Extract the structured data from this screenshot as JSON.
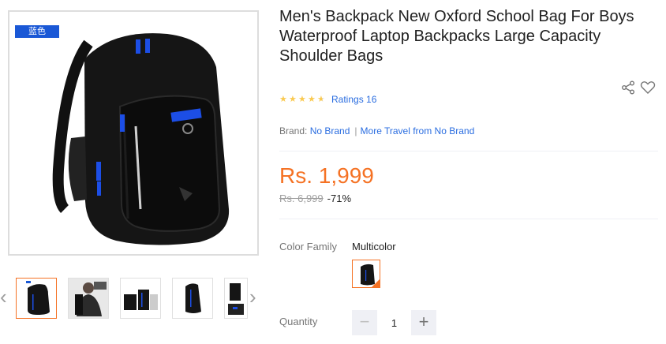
{
  "gallery": {
    "color_tag": "蓝色",
    "thumbnails": [
      {
        "name": "thumb-1",
        "active": true
      },
      {
        "name": "thumb-2",
        "active": false
      },
      {
        "name": "thumb-3",
        "active": false
      },
      {
        "name": "thumb-4",
        "active": false
      },
      {
        "name": "thumb-5",
        "active": false
      }
    ],
    "prev_icon": "chevron-left-icon",
    "next_icon": "chevron-right-icon"
  },
  "product": {
    "title": "Men's Backpack New Oxford School Bag For Boys Waterproof Laptop Backpacks Large Capacity Shoulder Bags",
    "rating": {
      "stars": 4.5,
      "label": "Ratings 16"
    },
    "brand": {
      "label": "Brand:",
      "value": "No Brand",
      "more": "More Travel from No Brand"
    },
    "price": "Rs. 1,999",
    "original_price": "Rs. 6,999",
    "discount": "-71%",
    "color_family": {
      "label": "Color Family",
      "value": "Multicolor"
    },
    "quantity": {
      "label": "Quantity",
      "value": "1",
      "minus": "−",
      "plus": "+"
    }
  },
  "colors": {
    "accent": "#f57224",
    "link": "#2a6de0",
    "star": "#faca51",
    "tag": "#1a58d6"
  }
}
